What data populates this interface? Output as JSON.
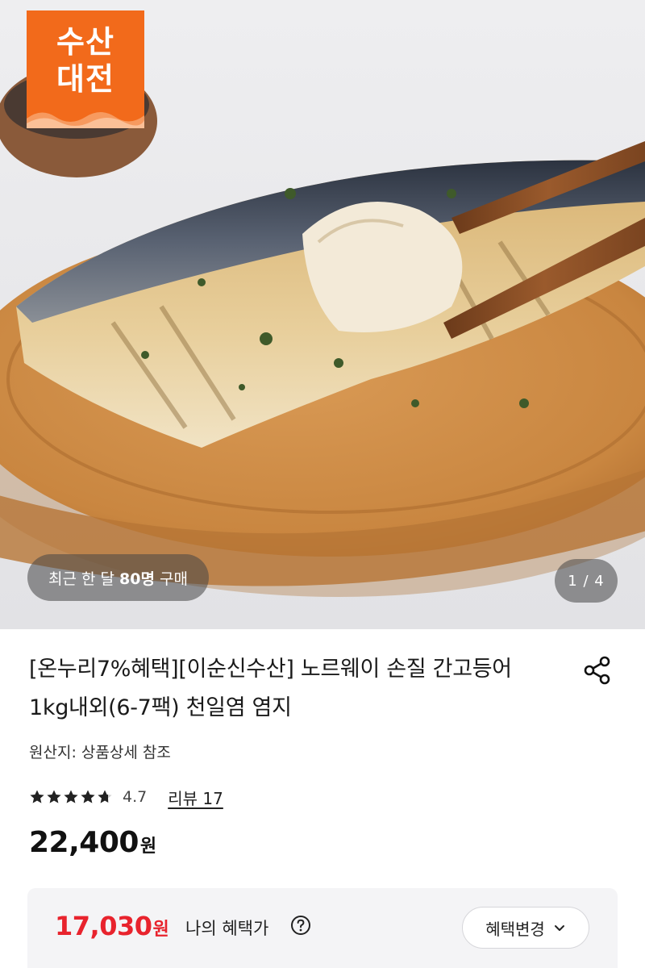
{
  "hero": {
    "badge_line1": "수산",
    "badge_line2": "대전",
    "buyers_prefix": "최근 한 달 ",
    "buyers_count": "80명",
    "buyers_suffix": " 구매",
    "image_counter": "1 / 4"
  },
  "product": {
    "title": "[온누리7%혜택][이순신수산] 노르웨이 손질 간고등어 1kg내외(6-7팩) 천일염 염지",
    "origin": "원산지: 상품상세 참조",
    "rating": "4.7",
    "rating_stars": 4.7,
    "review_link": "리뷰 17",
    "price": "22,400",
    "price_unit": "원"
  },
  "benefit": {
    "price": "17,030",
    "price_unit": "원",
    "label": "나의 혜택가",
    "change_button": "혜택변경"
  },
  "icons": [
    "share-icon",
    "star-icon",
    "help-icon",
    "chevron-down-icon"
  ],
  "colors": {
    "badge": "#f26a1b",
    "benefit_price": "#e8232d",
    "star": "#222222",
    "benefit_bg": "#f4f4f6"
  }
}
